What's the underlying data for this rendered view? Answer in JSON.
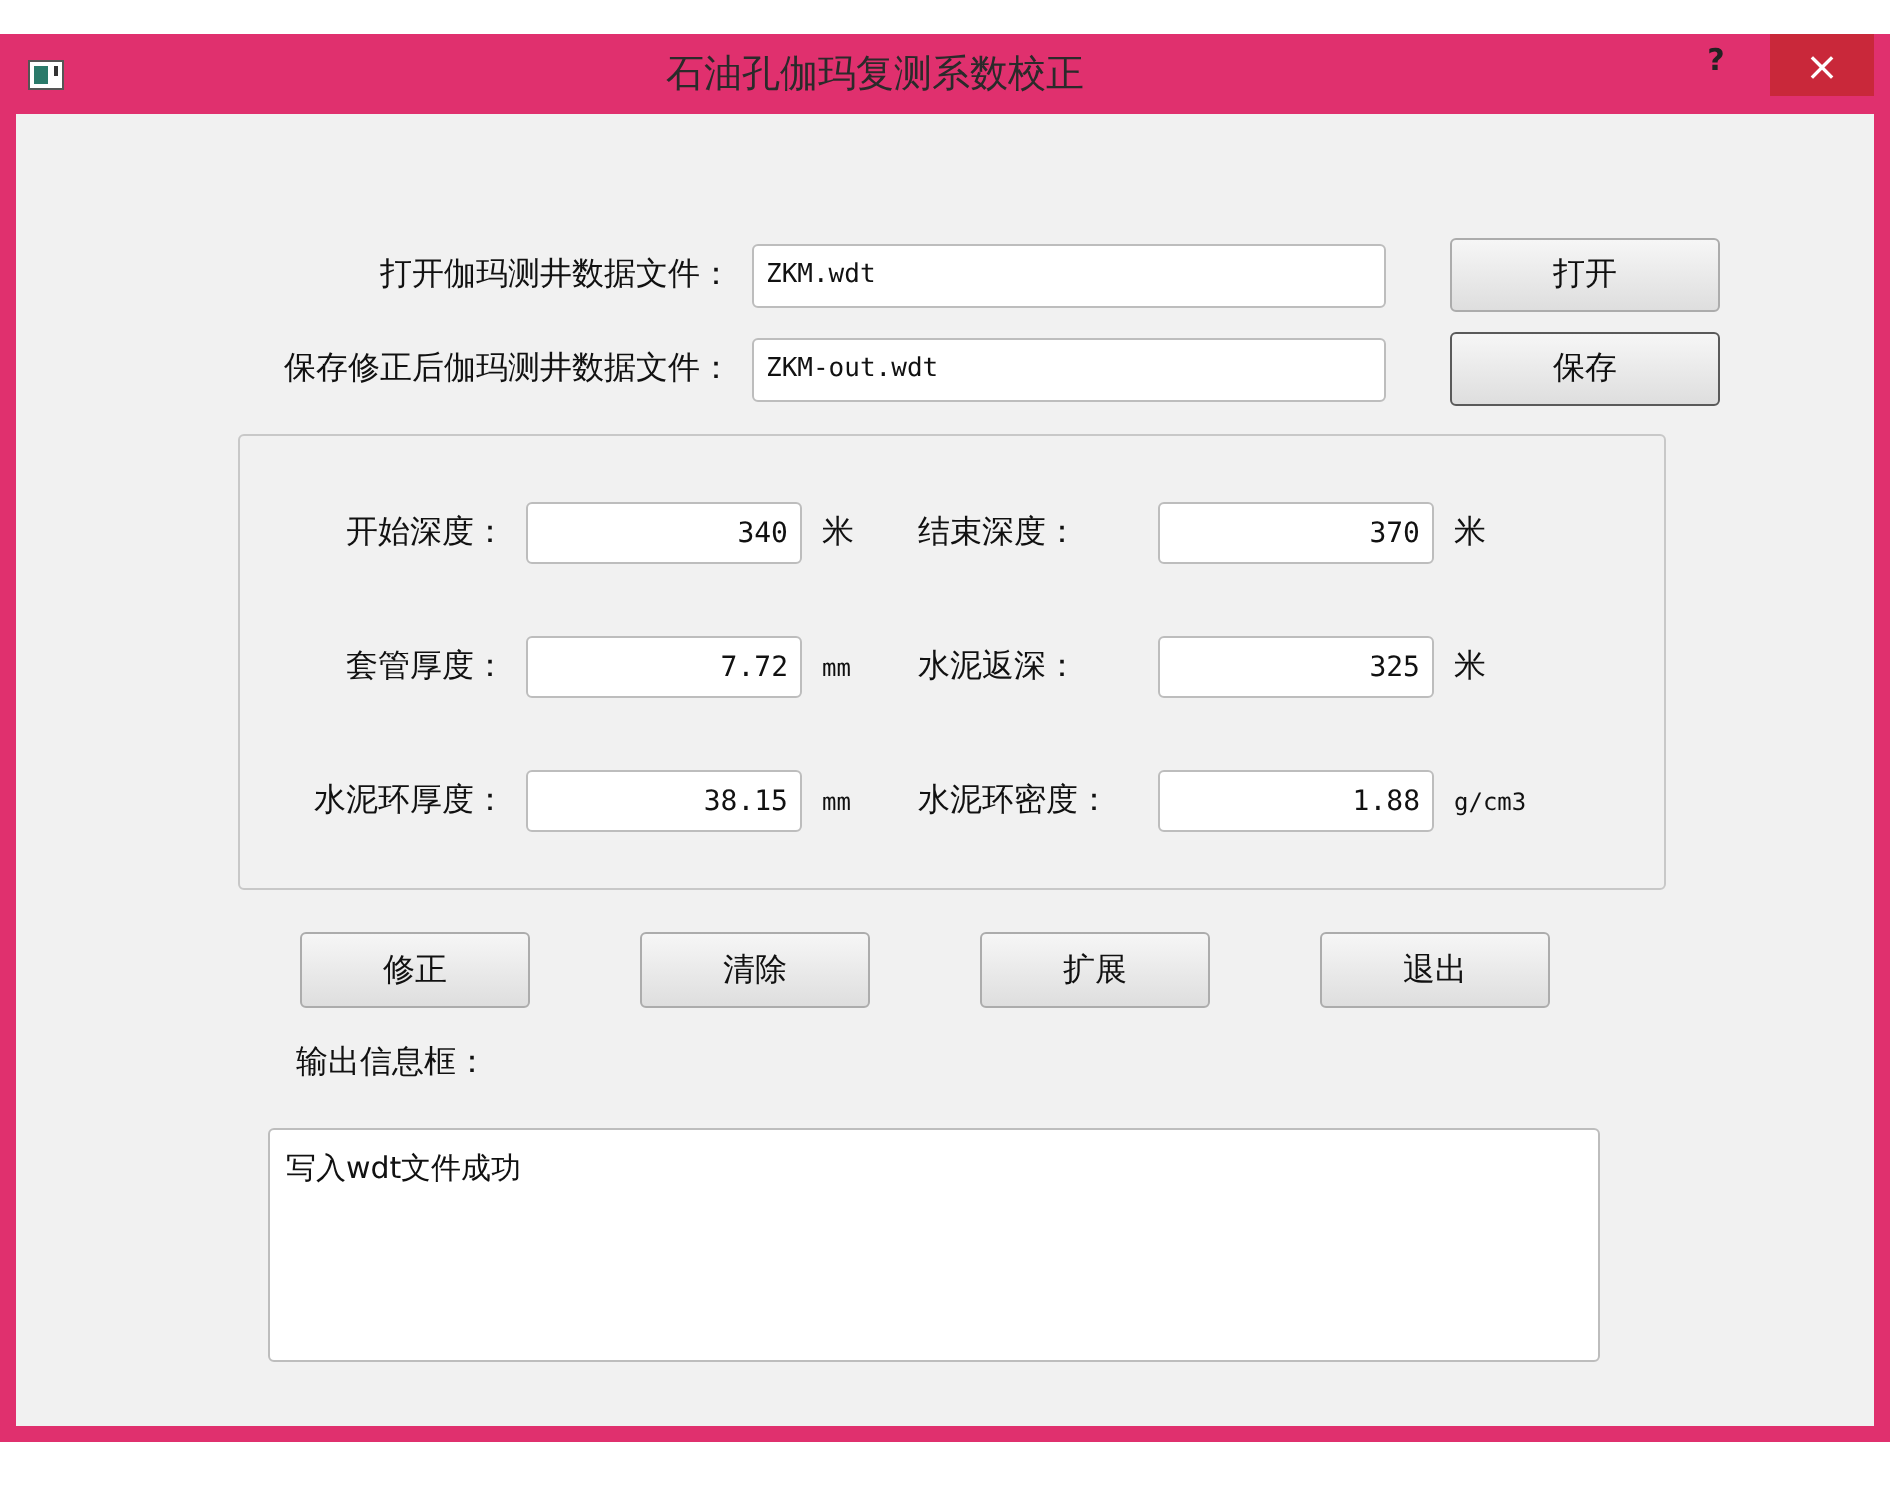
{
  "window": {
    "title": "石油孔伽玛复测系数校正",
    "help": "?",
    "close": "×"
  },
  "files": [
    {
      "label": "打开伽玛测井数据文件：",
      "value": "ZKM.wdt",
      "button": "打开",
      "default": false
    },
    {
      "label": "保存修正后伽玛测井数据文件：",
      "value": "ZKM-out.wdt",
      "button": "保存",
      "default": true
    }
  ],
  "params": [
    {
      "label": "开始深度：",
      "value": "340",
      "unit": "米"
    },
    {
      "label": "结束深度：",
      "value": "370",
      "unit": "米"
    },
    {
      "label": "套管厚度：",
      "value": "7.72",
      "unit": "mm"
    },
    {
      "label": "水泥返深：",
      "value": "325",
      "unit": "米"
    },
    {
      "label": "水泥环厚度：",
      "value": "38.15",
      "unit": "mm"
    },
    {
      "label": "水泥环密度：",
      "value": "1.88",
      "unit": "g/cm3"
    }
  ],
  "actions": [
    "修正",
    "清除",
    "扩展",
    "退出"
  ],
  "output": {
    "label": "输出信息框：",
    "text": "写入wdt文件成功"
  }
}
